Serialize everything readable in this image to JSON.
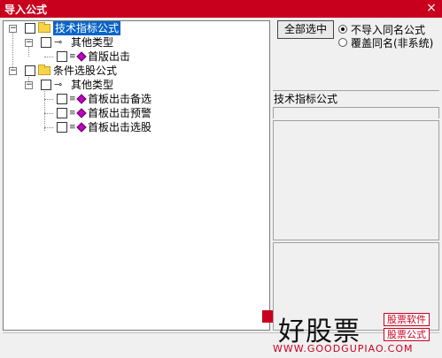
{
  "window": {
    "title": "导入公式",
    "close_glyph": "×"
  },
  "tree": {
    "root1": {
      "label": "技术指标公式",
      "expander": "−"
    },
    "root1_child": {
      "label": "其他类型",
      "expander": "−"
    },
    "root1_leaf": {
      "label": "首版出击"
    },
    "root2": {
      "label": "条件选股公式",
      "expander": "−"
    },
    "root2_child": {
      "label": "其他类型",
      "expander": "−"
    },
    "root2_leaves": [
      "首板出击备选",
      "首板出击预警",
      "首板出击选股"
    ]
  },
  "controls": {
    "select_all": "全部选中",
    "radio_skip": "不导入同名公式",
    "radio_overwrite": "覆盖同名(非系统)"
  },
  "detail": {
    "formula_name": "技术指标公式"
  },
  "watermark": {
    "brand": "好股票",
    "tag1": "股票软件",
    "tag2": "股票公式",
    "url": "WWW.GOODGUPIAO.COM"
  }
}
